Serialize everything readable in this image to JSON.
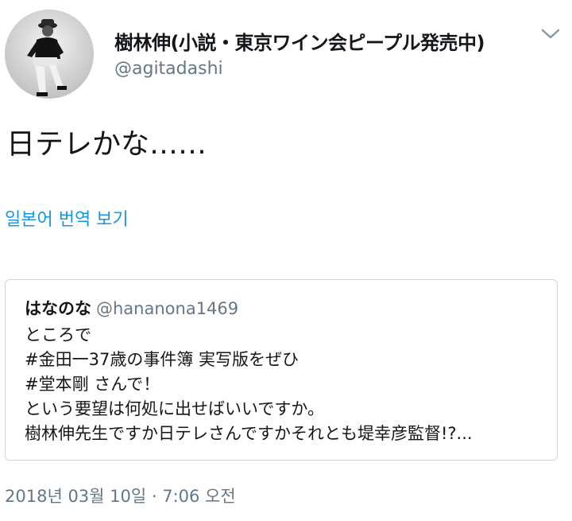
{
  "author": {
    "display_name": "樹林伸(小説・東京ワイン会ピープル発売中)",
    "handle": "@agitadashi"
  },
  "tweet": {
    "text": "日テレかな……",
    "translate_link": "일본어 번역 보기",
    "timestamp": "2018년 03월 10일 · 7:06 오전"
  },
  "quoted_tweet": {
    "display_name": "はなのな",
    "handle": "@hananona1469",
    "lines": [
      "ところで",
      "#金田一37歳の事件簿 実写版をぜひ",
      "#堂本剛 さんで！",
      "という要望は何処に出せばいいですか。",
      "樹林伸先生ですか日テレさんですかそれとも堤幸彦監督!?..."
    ]
  },
  "icons": {
    "menu": "chevron-down-icon",
    "avatar": "profile-photo"
  },
  "colors": {
    "link": "#1b95e0",
    "secondary_text": "#657786",
    "border": "#ccd6dd"
  }
}
